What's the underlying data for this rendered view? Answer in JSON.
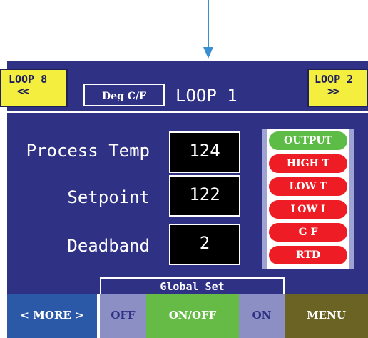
{
  "header": {
    "loop_prev": {
      "line1": "LOOP 8",
      "line2": "<<"
    },
    "loop_next": {
      "line1": "LOOP 2",
      "line2": ">>"
    },
    "deg_button": "Deg C/F",
    "loop_title": "LOOP 1"
  },
  "rows": [
    {
      "label": "Process Temp",
      "value": "124"
    },
    {
      "label": "Setpoint",
      "value": "122"
    },
    {
      "label": "Deadband",
      "value": "2"
    }
  ],
  "status": [
    {
      "label": "OUTPUT",
      "color": "#5cbc45"
    },
    {
      "label": "HIGH T",
      "color": "#ee1c24"
    },
    {
      "label": "LOW T",
      "color": "#ee1c24"
    },
    {
      "label": "LOW I",
      "color": "#ee1c24"
    },
    {
      "label": "G F",
      "color": "#ee1c24"
    },
    {
      "label": "RTD",
      "color": "#ee1c24"
    }
  ],
  "footer": {
    "global_set": "Global Set",
    "more": "< MORE >",
    "off": "OFF",
    "onoff": "ON/OFF",
    "on": "ON",
    "menu": "MENU"
  },
  "colors": {
    "panel": "#2e3184",
    "loop_nav": "#f4ef3f",
    "arrow": "#3a8fd0",
    "more_button": "#2b59a8",
    "off_on_button": "#8c8fc4",
    "onoff_button": "#66bb46",
    "menu_button": "#6b6324"
  }
}
